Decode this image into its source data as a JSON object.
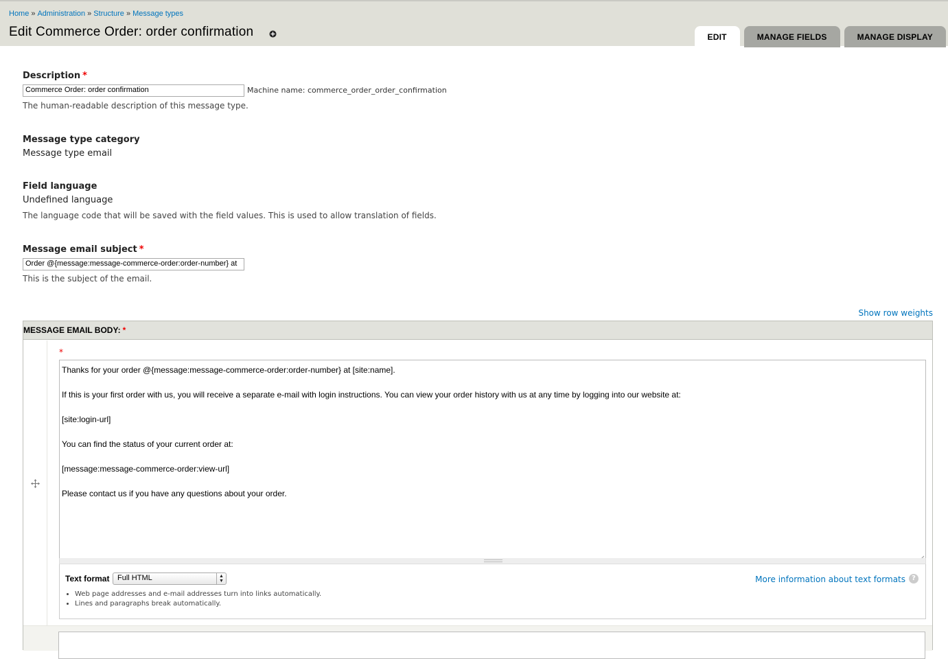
{
  "breadcrumb": {
    "items": [
      "Home",
      "Administration",
      "Structure",
      "Message types"
    ],
    "separator": "»"
  },
  "page_title": "Edit Commerce Order: order confirmation",
  "tabs": [
    {
      "label": "EDIT",
      "active": true
    },
    {
      "label": "MANAGE FIELDS",
      "active": false
    },
    {
      "label": "MANAGE DISPLAY",
      "active": false
    }
  ],
  "description": {
    "label": "Description",
    "required_mark": "*",
    "value": "Commerce Order: order confirmation",
    "machine_name": "Machine name: commerce_order_order_confirmation",
    "help": "The human-readable description of this message type."
  },
  "category": {
    "label": "Message type category",
    "value": "Message type email"
  },
  "language": {
    "label": "Field language",
    "value": "Undefined language",
    "help": "The language code that will be saved with the field values. This is used to allow translation of fields."
  },
  "subject": {
    "label": "Message email subject",
    "required_mark": "*",
    "value": "Order @{message:message-commerce-order:order-number} at",
    "help": "This is the subject of the email."
  },
  "show_row_weights": "Show row weights",
  "body": {
    "header": "MESSAGE EMAIL BODY:",
    "required_mark": "*",
    "lines": [
      "Thanks for your order @{message:message-commerce-order:order-number} at [site:name].",
      "If this is your first order with us, you will receive a separate e-mail with login instructions. You can view your order history with us at any time by logging into our website at:",
      "[site:login-url]",
      "You can find the status of your current order at:",
      "[message:message-commerce-order:view-url]",
      "Please contact us if you have any questions about your order."
    ],
    "text_format_label": "Text format",
    "text_format_value": "Full HTML",
    "format_tips": [
      "Web page addresses and e-mail addresses turn into links automatically.",
      "Lines and paragraphs break automatically."
    ],
    "more_info": "More information about text formats",
    "help_icon": "?"
  },
  "colors": {
    "link": "#0074bd",
    "required": "#ee0000",
    "header_bg": "#e0e0d8",
    "tab_bg": "#a6a7a2"
  }
}
